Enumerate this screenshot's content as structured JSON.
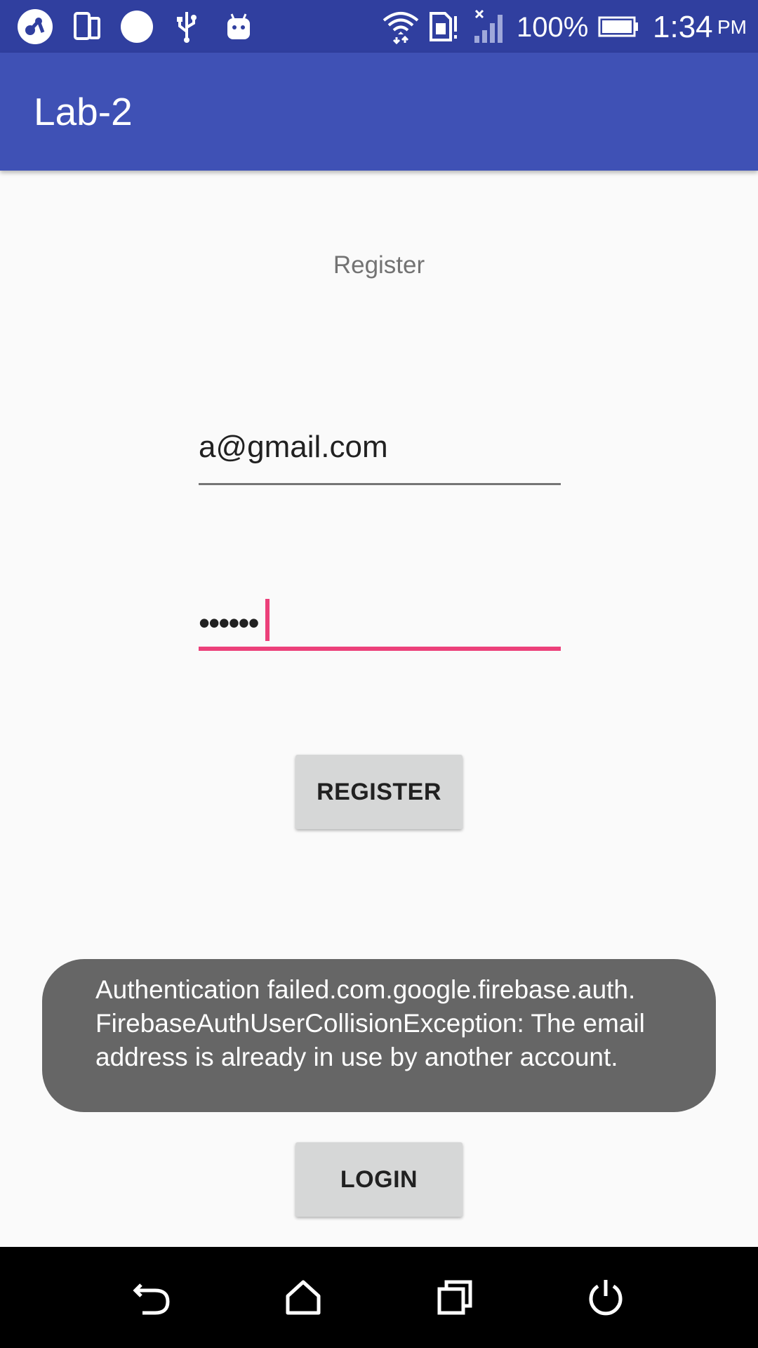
{
  "status_bar": {
    "battery_percent": "100%",
    "time": "1:34",
    "ampm": "PM",
    "icons": [
      "app-notification-icon",
      "phone-device-icon",
      "dot-notification-icon",
      "usb-icon",
      "android-debug-icon",
      "wifi-icon",
      "sim-alert-icon",
      "no-signal-icon",
      "battery-icon"
    ]
  },
  "app_bar": {
    "title": "Lab-2"
  },
  "form": {
    "heading": "Register",
    "email_value": "a@gmail.com",
    "password_value": "••••••",
    "register_label": "REGISTER",
    "login_label": "LOGIN"
  },
  "toast": {
    "lines": [
      "Authentication failed.com.google.firebase.auth.",
      "FirebaseAuthUserCollisionException: The email",
      "address is already in use by another account."
    ]
  },
  "nav_bar": {
    "icons": [
      "back-icon",
      "home-icon",
      "recents-icon",
      "power-icon"
    ]
  },
  "colors": {
    "status_bar": "#303f9f",
    "app_bar": "#3f51b5",
    "accent": "#ec407a",
    "toast": "#666666"
  }
}
